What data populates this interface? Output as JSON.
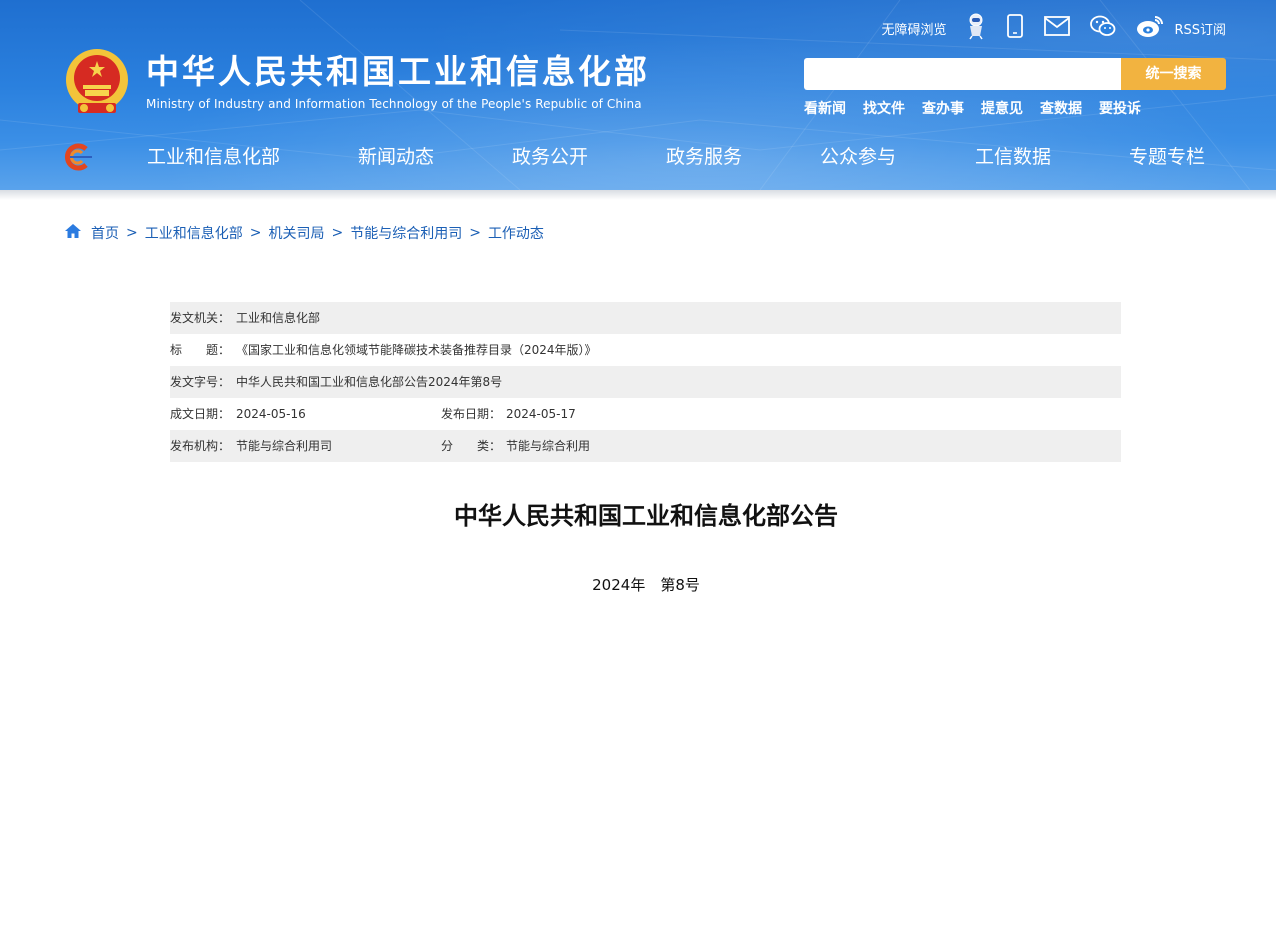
{
  "header": {
    "title_cn": "中华人民共和国工业和信息化部",
    "title_en": "Ministry of Industry and Information Technology of the People's Republic of China",
    "accessibility": "无障碍浏览",
    "rss": "RSS订阅",
    "icons": [
      "accessibility-robot-icon",
      "mobile-icon",
      "mail-icon",
      "wechat-icon",
      "weibo-icon"
    ],
    "search": {
      "placeholder": "",
      "button": "统一搜索"
    },
    "quick_links": [
      "看新闻",
      "找文件",
      "查办事",
      "提意见",
      "查数据",
      "要投诉"
    ]
  },
  "nav": {
    "items": [
      "工业和信息化部",
      "新闻动态",
      "政务公开",
      "政务服务",
      "公众参与",
      "工信数据",
      "专题专栏"
    ]
  },
  "breadcrumb": [
    "首页",
    "工业和信息化部",
    "机关司局",
    "节能与综合利用司",
    "工作动态"
  ],
  "breadcrumb_sep": ">",
  "meta": {
    "issuer_label": "发文机关：",
    "issuer": "工业和信息化部",
    "title_label": "标　　题：",
    "title": "《国家工业和信息化领域节能降碳技术装备推荐目录（2024年版）》",
    "doc_no_label": "发文字号：",
    "doc_no": "中华人民共和国工业和信息化部公告2024年第8号",
    "written_label": "成文日期：",
    "written": "2024-05-16",
    "published_label": "发布日期：",
    "published": "2024-05-17",
    "org_label": "发布机构：",
    "org": "节能与综合利用司",
    "category_label": "分　　类：",
    "category": "节能与综合利用"
  },
  "document": {
    "title": "中华人民共和国工业和信息化部公告",
    "number": "2024年　第8号"
  },
  "colors": {
    "header_blue": "#2a80de",
    "search_button": "#f2b340",
    "link_blue": "#1b5fb5",
    "meta_row_gray": "#efefef"
  }
}
